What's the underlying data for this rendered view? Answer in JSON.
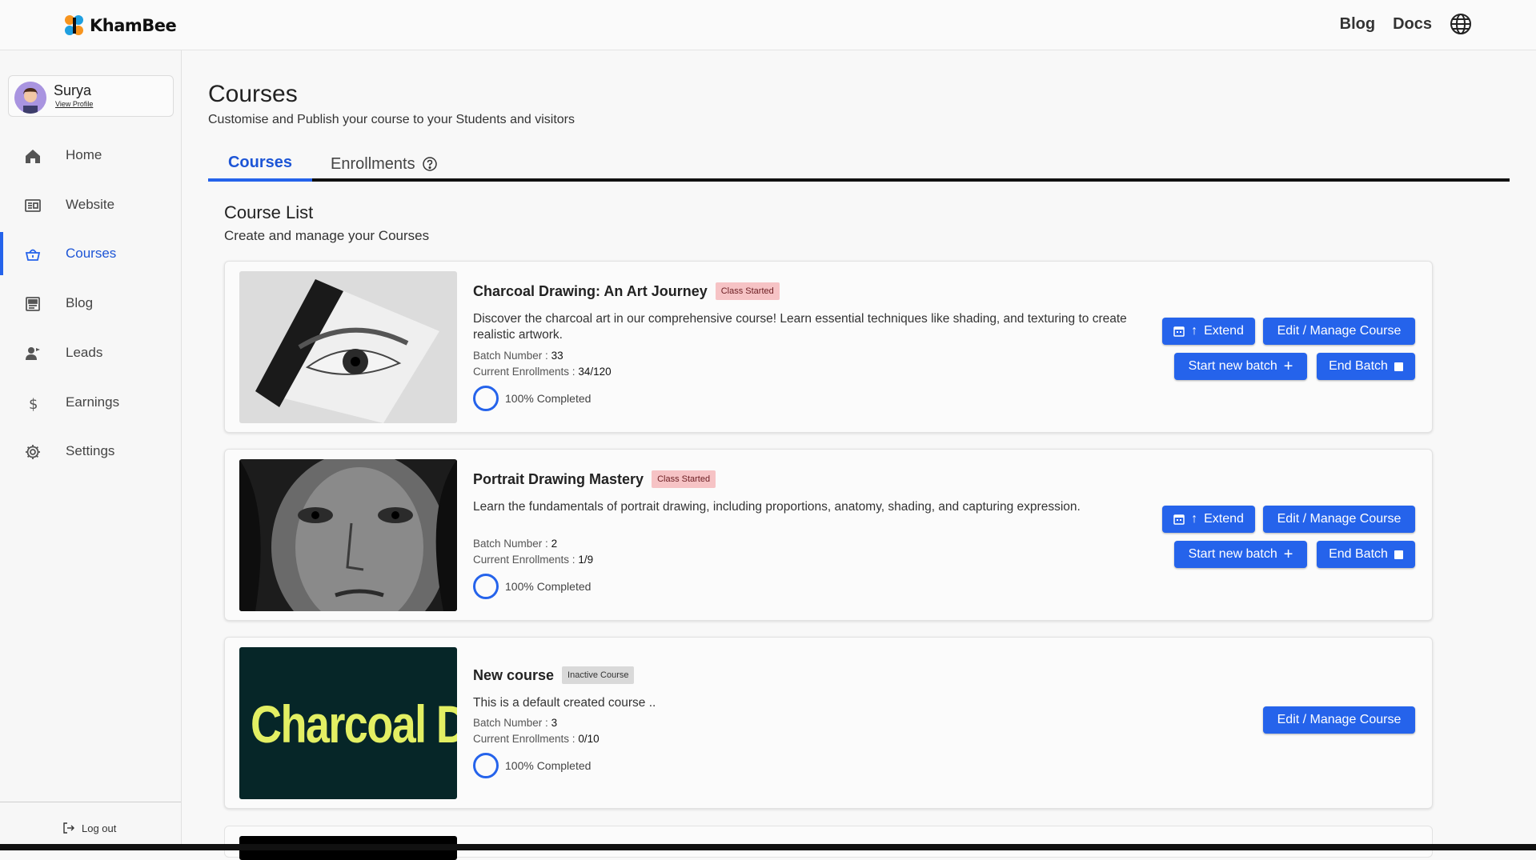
{
  "header": {
    "logo_text": "KhamBee",
    "links": [
      "Blog",
      "Docs"
    ]
  },
  "sidebar": {
    "profile": {
      "name": "Surya",
      "link": "View Profile"
    },
    "items": [
      {
        "label": "Home",
        "icon": "home-icon"
      },
      {
        "label": "Website",
        "icon": "website-icon"
      },
      {
        "label": "Courses",
        "icon": "courses-icon",
        "active": true
      },
      {
        "label": "Blog",
        "icon": "blog-icon"
      },
      {
        "label": "Leads",
        "icon": "leads-icon"
      },
      {
        "label": "Earnings",
        "icon": "dollar-icon"
      },
      {
        "label": "Settings",
        "icon": "gear-icon"
      }
    ],
    "logout": "Log out"
  },
  "main": {
    "title": "Courses",
    "subtitle": "Customise and Publish your course to your Students and visitors",
    "tabs": [
      "Courses",
      "Enrollments"
    ],
    "list_title": "Course List",
    "list_subtitle": "Create and manage your Courses",
    "batch_label": "Batch Number :",
    "enroll_label": "Current Enrollments :",
    "buttons": {
      "extend": "Extend",
      "edit": "Edit / Manage Course",
      "new_batch": "Start new batch",
      "end_batch": "End Batch"
    },
    "courses": [
      {
        "title": "Charcoal Drawing: An Art Journey",
        "badge": "Class Started",
        "description": "Discover the charcoal art in our comprehensive course! Learn essential techniques like shading, and texturing to create realistic artwork.",
        "batch": "33",
        "enrollments": "34/120",
        "progress": "100% Completed"
      },
      {
        "title": "Portrait Drawing Mastery",
        "badge": "Class Started",
        "description": "Learn the fundamentals of portrait drawing, including proportions, anatomy, shading, and capturing expression.",
        "batch": "2",
        "enrollments": "1/9",
        "progress": "100% Completed"
      },
      {
        "title": "New course",
        "badge": "Inactive Course",
        "description": "This is a default created course ..",
        "batch": "3",
        "enrollments": "0/10",
        "progress": "100% Completed",
        "thumb_text": "Charcoal Dr"
      }
    ]
  },
  "colors": {
    "primary": "#2563eb",
    "badge_started": "#f6c3c5",
    "badge_inactive": "#d9d9d9"
  }
}
